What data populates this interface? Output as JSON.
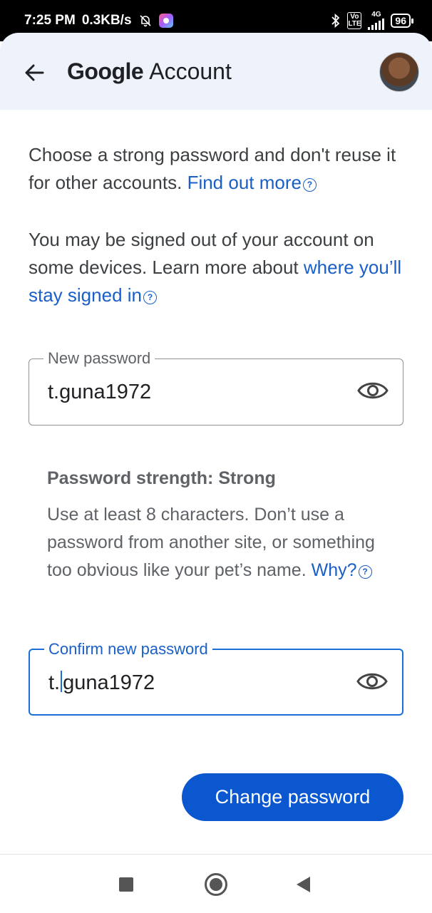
{
  "status_bar": {
    "time": "7:25 PM",
    "speed": "0.3KB/s",
    "bell_icon": "bell-muted-icon",
    "network_top": "4G",
    "volte": "Vo LTE",
    "battery": "96"
  },
  "header": {
    "brand_google": "Google",
    "brand_account": "Account"
  },
  "intro": {
    "text": "Choose a strong password and don't reuse it for other accounts. ",
    "link": "Find out more"
  },
  "signout_notice": {
    "text": "You may be signed out of your account on some devices. Learn more about ",
    "link": "where you’ll stay signed in"
  },
  "new_password": {
    "label": "New password",
    "value": "t.guna1972"
  },
  "strength": {
    "title": "Password strength: Strong",
    "text": "Use at least 8 characters. Don’t use a password from another site, or something too obvious like your pet’s name. ",
    "link": "Why?"
  },
  "confirm_password": {
    "label": "Confirm new password",
    "value_before_caret": "t.",
    "value_after_caret": "guna1972"
  },
  "change_button": "Change password",
  "help_glyph": "?",
  "colors": {
    "link": "#1a5fc8",
    "primary_button": "#0b57d0",
    "header_bg": "#eef2fa",
    "focus_border": "#1a6fd6"
  }
}
